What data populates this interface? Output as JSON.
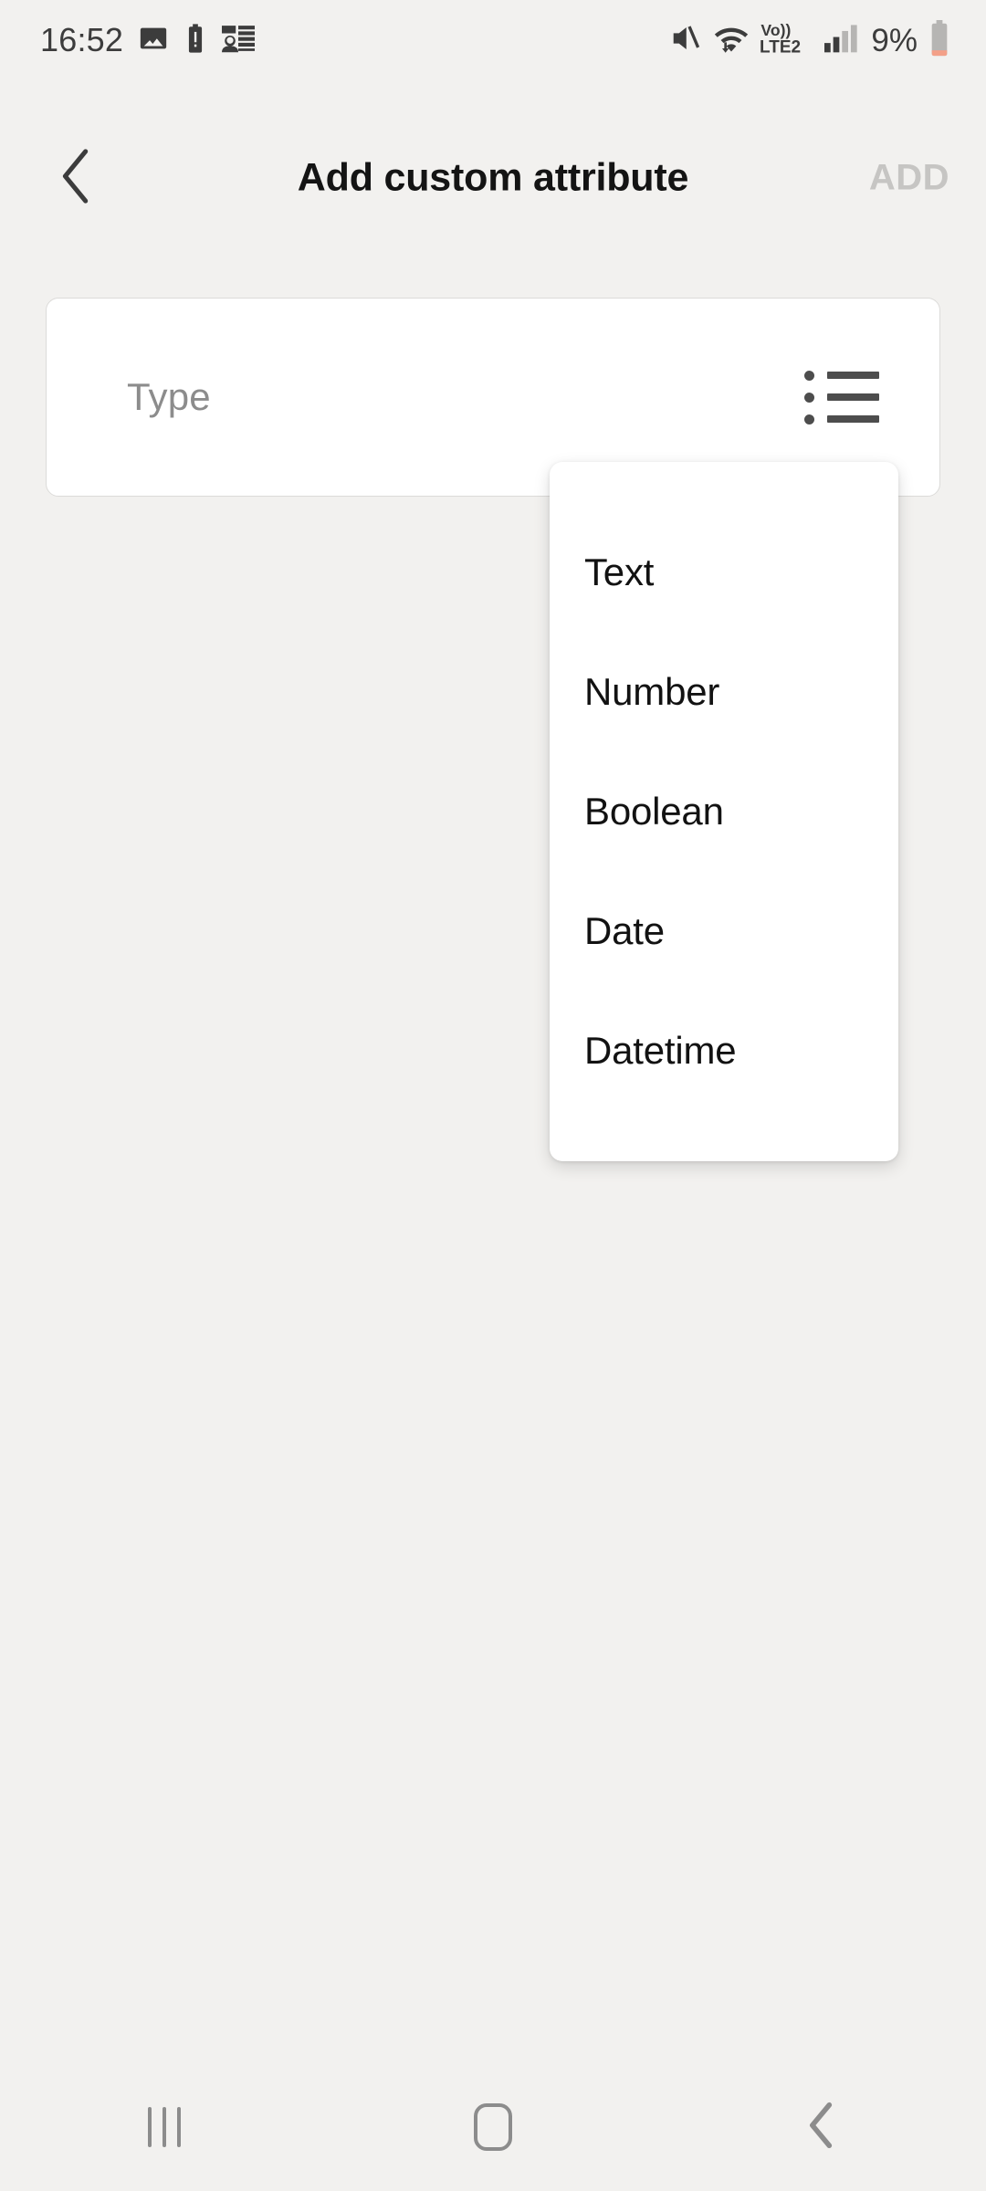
{
  "status_bar": {
    "time": "16:52",
    "left_icons": [
      "image-icon",
      "battery-alert-icon",
      "contacts-icon"
    ],
    "right_icons": [
      "mute-icon",
      "wifi-icon",
      "volte-lte2-icon",
      "signal-icon"
    ],
    "network_label_top": "Vo))",
    "network_label_bottom": "LTE2",
    "battery_percent": "9%",
    "text_color": "#3c3c3c",
    "battery_accent_color": "#f2a38a"
  },
  "header": {
    "back_icon": "chevron-left-icon",
    "title": "Add custom attribute",
    "action_label": "ADD",
    "action_disabled_color": "#c6c5c3"
  },
  "form": {
    "type_field": {
      "label": "Type",
      "value": "",
      "placeholder": "Type",
      "trailing_icon": "list-bullet-icon"
    }
  },
  "dropdown": {
    "visible": true,
    "options": [
      {
        "label": "Text"
      },
      {
        "label": "Number"
      },
      {
        "label": "Boolean"
      },
      {
        "label": "Date"
      },
      {
        "label": "Datetime"
      }
    ]
  },
  "nav_bar": {
    "recents_icon": "recents-icon",
    "home_icon": "home-icon",
    "back_icon": "nav-back-icon",
    "icon_color": "#8c8c8c"
  },
  "colors": {
    "page_background": "#f2f1ef",
    "surface": "#ffffff",
    "field_border": "#dcdbd9",
    "primary_text": "#141414",
    "secondary_text": "#8c8c8c"
  }
}
